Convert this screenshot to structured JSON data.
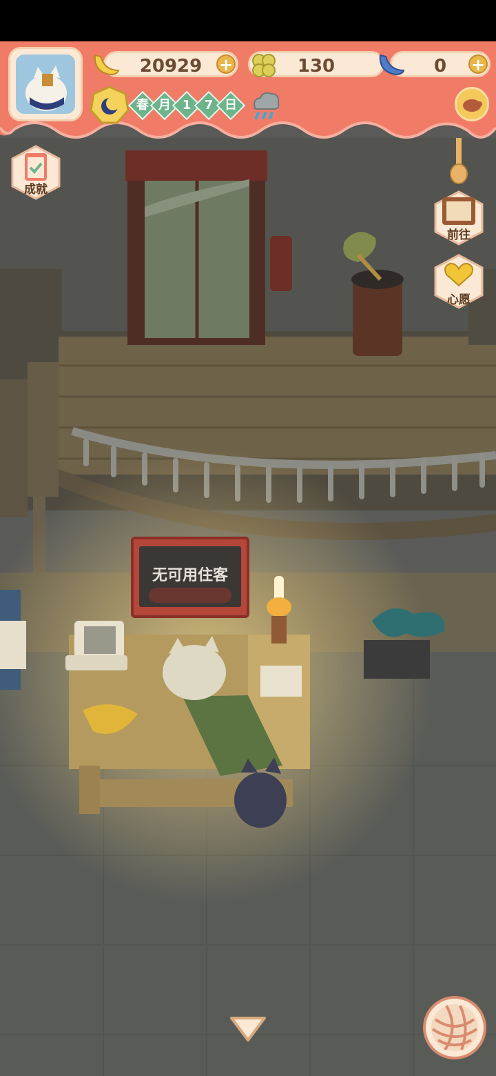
{
  "hud": {
    "bananas": "20929",
    "clovers": "130",
    "special_bananas": "0",
    "date": [
      "春",
      "月",
      "1",
      "7",
      "日"
    ],
    "weather_icon": "rain-cloud-icon"
  },
  "side_buttons": {
    "achievement": "成就",
    "goto": "前往",
    "wish": "心愿"
  },
  "sign": {
    "text": "无可用住客"
  },
  "colors": {
    "header_bg": "#f07c68",
    "pill_bg": "#fbe9d6",
    "date_chip": "#6db48a",
    "floor": "#5a5b58"
  }
}
